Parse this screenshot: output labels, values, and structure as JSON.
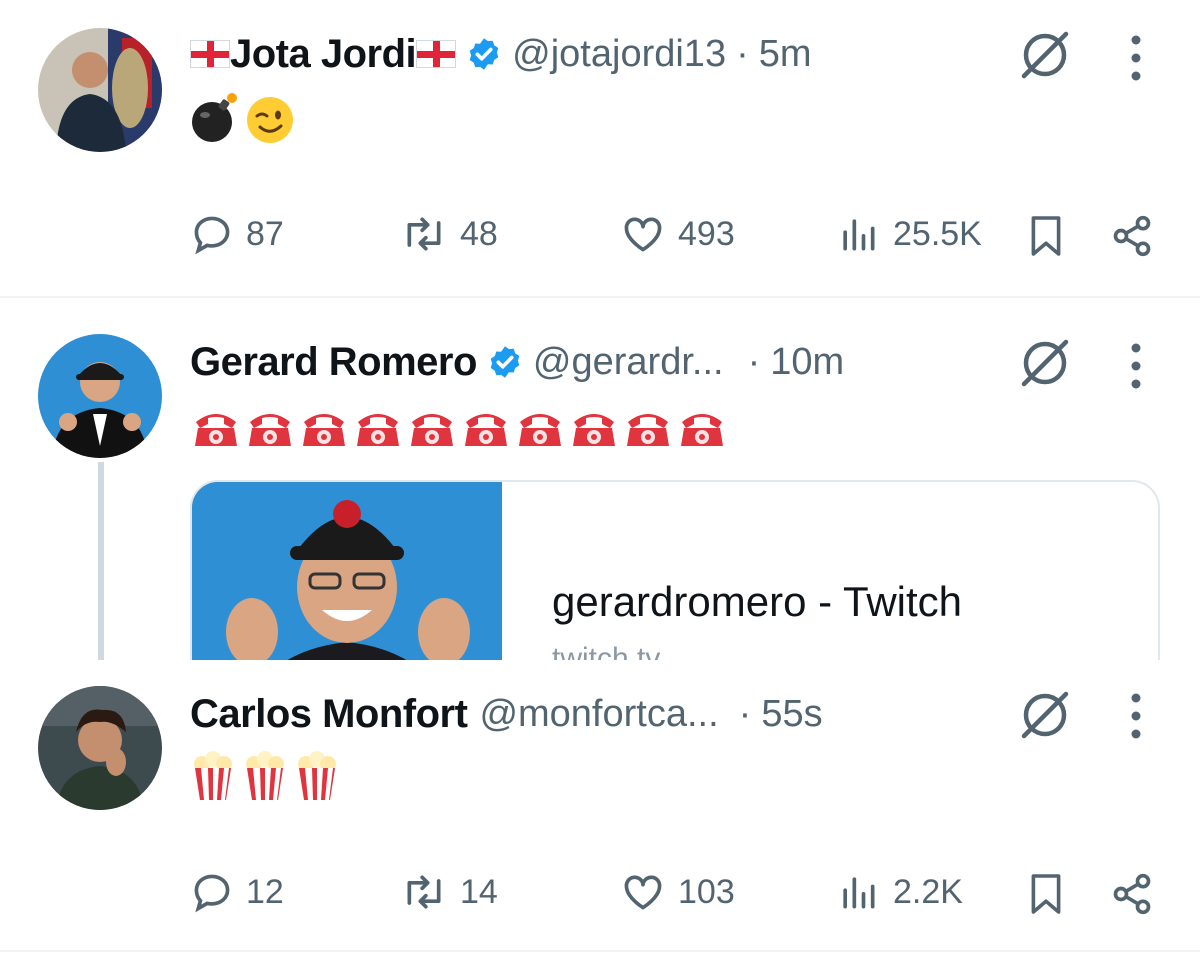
{
  "tweets": [
    {
      "name": "Jota Jordi",
      "handle": "@jotajordi13",
      "separator": "·",
      "time": "5m",
      "content_emojis": [
        "💣",
        "😉"
      ],
      "actions": {
        "replies": "87",
        "retweets": "48",
        "likes": "493",
        "views": "25.5K"
      }
    },
    {
      "name": "Gerard Romero",
      "handle": "@gerardr...",
      "separator": "·",
      "time": "10m",
      "content_emojis": [
        "☎️",
        "☎️",
        "☎️",
        "☎️",
        "☎️",
        "☎️",
        "☎️",
        "☎️",
        "☎️",
        "☎️"
      ],
      "card": {
        "title": "gerardromero - Twitch",
        "subtitle": "twitch.tv"
      }
    },
    {
      "name": "Carlos Monfort",
      "handle": "@monfortca...",
      "separator": "·",
      "time": "55s",
      "content_emojis": [
        "🍿",
        "🍿",
        "🍿"
      ],
      "actions": {
        "replies": "12",
        "retweets": "14",
        "likes": "103",
        "views": "2.2K"
      }
    }
  ],
  "colors": {
    "verified": "#1d9bf0",
    "secondary_text": "#536471",
    "divider": "#eff3f4"
  },
  "icons": [
    "verified-badge-icon",
    "grok-icon",
    "more-icon",
    "reply-icon",
    "retweet-icon",
    "like-icon",
    "views-icon",
    "bookmark-icon",
    "share-icon"
  ]
}
